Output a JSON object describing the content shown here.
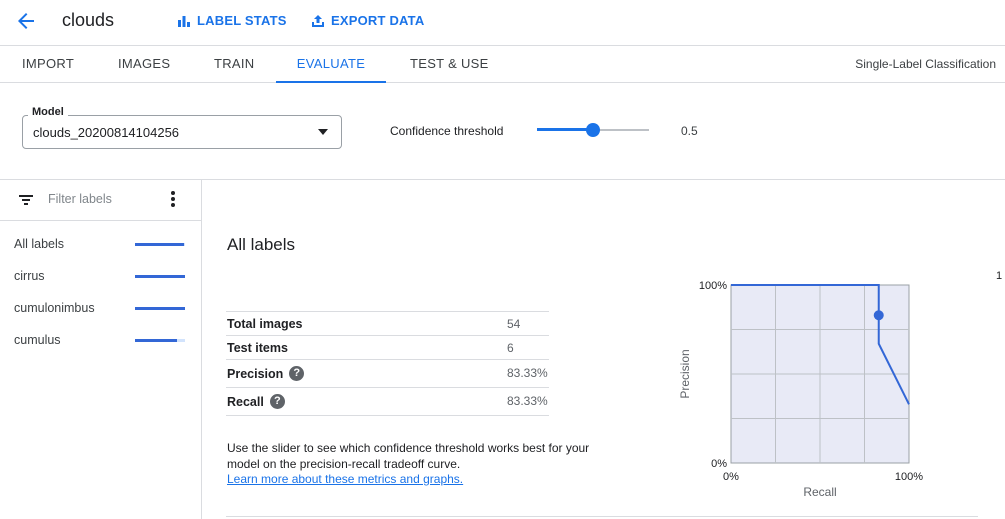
{
  "header": {
    "title": "clouds",
    "label_stats": "LABEL STATS",
    "export_data": "EXPORT DATA"
  },
  "tabs": [
    {
      "label": "IMPORT",
      "active": false
    },
    {
      "label": "IMAGES",
      "active": false
    },
    {
      "label": "TRAIN",
      "active": false
    },
    {
      "label": "EVALUATE",
      "active": true
    },
    {
      "label": "TEST & USE",
      "active": false
    }
  ],
  "model_type": "Single-Label Classification",
  "model": {
    "label": "Model",
    "value": "clouds_20200814104256"
  },
  "confidence": {
    "label": "Confidence threshold",
    "value": "0.5",
    "level": 0.5
  },
  "sidebar": {
    "filter_placeholder": "Filter labels",
    "labels": [
      {
        "name": "All labels",
        "score": 0.98
      },
      {
        "name": "cirrus",
        "score": 1.0
      },
      {
        "name": "cumulonimbus",
        "score": 1.0
      },
      {
        "name": "cumulus",
        "score": 0.83
      }
    ]
  },
  "main": {
    "title": "All labels",
    "stats": [
      {
        "key": "Total images",
        "value": "54",
        "help": false
      },
      {
        "key": "Test items",
        "value": "6",
        "help": false
      },
      {
        "key": "Precision",
        "value": "83.33%",
        "help": true
      },
      {
        "key": "Recall",
        "value": "83.33%",
        "help": true
      }
    ],
    "help_text": "Use the slider to see which confidence threshold works best for your model on the precision-recall tradeoff curve.",
    "learn_more": "Learn more about these metrics and graphs."
  },
  "chart_data": {
    "type": "line",
    "xlabel": "Recall",
    "ylabel": "Precision",
    "xticks": [
      "0%",
      "100%"
    ],
    "yticks": [
      "100%",
      "0%"
    ],
    "xlim": [
      0,
      1
    ],
    "ylim": [
      0,
      1
    ],
    "grid": true,
    "series": [
      {
        "x": [
          0,
          0.83,
          0.83,
          1.0
        ],
        "y": [
          1.0,
          1.0,
          0.67,
          0.33
        ]
      }
    ],
    "marker": {
      "x": 0.83,
      "y": 0.83
    }
  },
  "edge_text": "1",
  "colors": {
    "accent": "#1a73e8",
    "line": "#3367d6",
    "plot_bg": "#e8eaf6"
  }
}
